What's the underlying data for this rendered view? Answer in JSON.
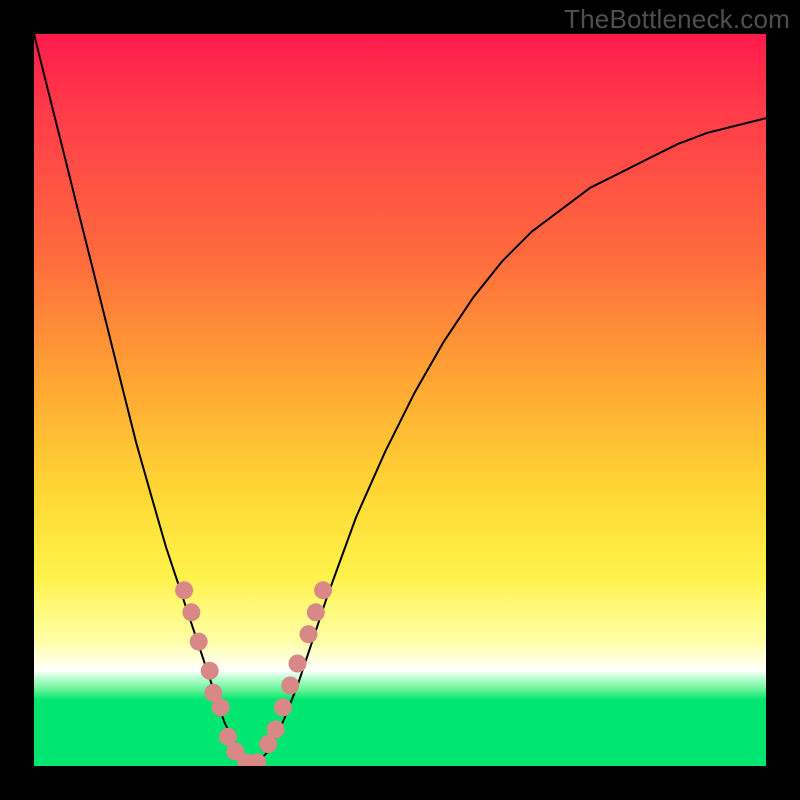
{
  "watermark": "TheBottleneck.com",
  "chart_data": {
    "type": "line",
    "title": "",
    "xlabel": "",
    "ylabel": "",
    "xlim": [
      0,
      100
    ],
    "ylim": [
      0,
      100
    ],
    "series": [
      {
        "name": "bottleneck-curve",
        "x": [
          0,
          2,
          4,
          6,
          8,
          10,
          12,
          14,
          16,
          18,
          20,
          22,
          24,
          25,
          26,
          27,
          28,
          29,
          30,
          32,
          34,
          36,
          38,
          40,
          44,
          48,
          52,
          56,
          60,
          64,
          68,
          72,
          76,
          80,
          84,
          88,
          92,
          96,
          100
        ],
        "y": [
          100,
          92,
          84,
          76,
          68,
          60,
          52,
          44,
          37,
          30,
          24,
          18,
          12,
          9,
          6,
          4,
          2,
          1,
          0,
          2,
          6,
          11,
          17,
          23,
          34,
          43,
          51,
          58,
          64,
          69,
          73,
          76,
          79,
          81,
          83,
          85,
          86.5,
          87.5,
          88.5
        ]
      }
    ],
    "markers": {
      "name": "highlight-dots",
      "color": "#d98888",
      "points": [
        {
          "x": 20.5,
          "y": 24
        },
        {
          "x": 21.5,
          "y": 21
        },
        {
          "x": 22.5,
          "y": 17
        },
        {
          "x": 24,
          "y": 13
        },
        {
          "x": 24.5,
          "y": 10
        },
        {
          "x": 25.5,
          "y": 8
        },
        {
          "x": 26.5,
          "y": 4
        },
        {
          "x": 27.5,
          "y": 2
        },
        {
          "x": 29,
          "y": 0.5
        },
        {
          "x": 30.5,
          "y": 0.5
        },
        {
          "x": 32,
          "y": 3
        },
        {
          "x": 33,
          "y": 5
        },
        {
          "x": 34,
          "y": 8
        },
        {
          "x": 35,
          "y": 11
        },
        {
          "x": 36,
          "y": 14
        },
        {
          "x": 37.5,
          "y": 18
        },
        {
          "x": 38.5,
          "y": 21
        },
        {
          "x": 39.5,
          "y": 24
        }
      ]
    },
    "gradient_stops": [
      {
        "pos": 0,
        "color": "#ff1a4b"
      },
      {
        "pos": 50,
        "color": "#ffb733"
      },
      {
        "pos": 85,
        "color": "#ffffe0"
      },
      {
        "pos": 90,
        "color": "#00e670"
      },
      {
        "pos": 100,
        "color": "#00e670"
      }
    ]
  }
}
